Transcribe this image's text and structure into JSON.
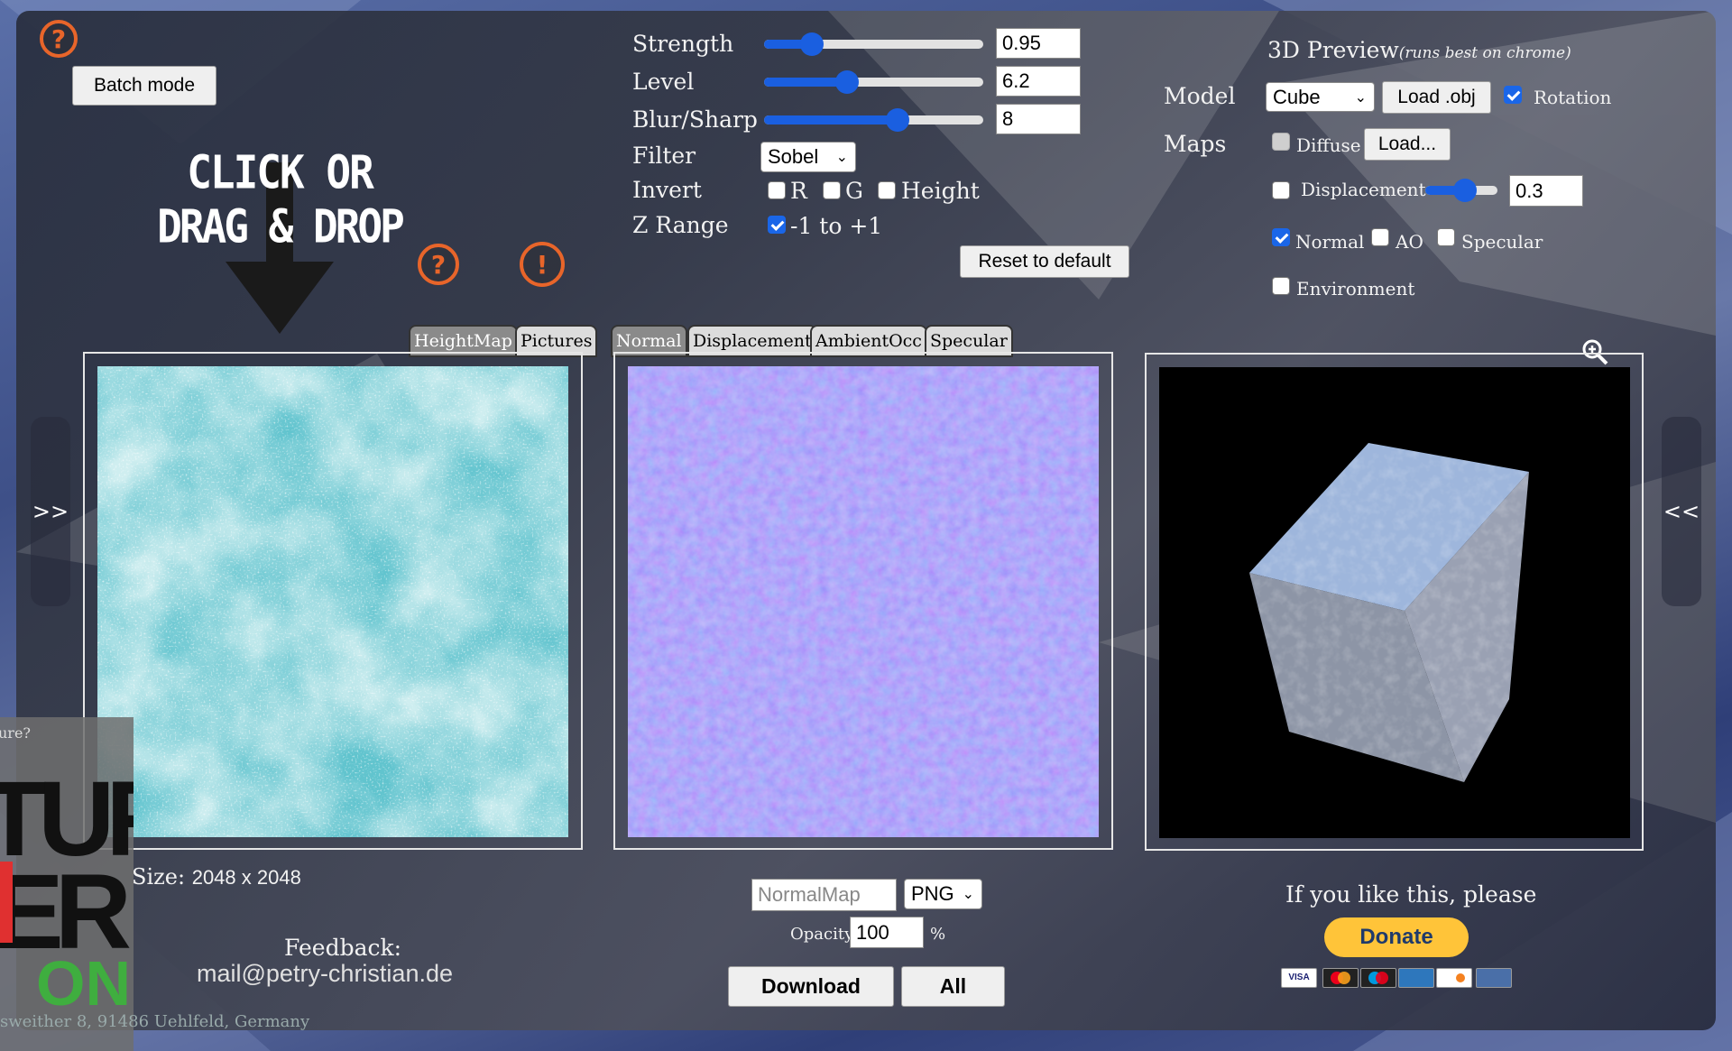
{
  "toolbar": {
    "batch_mode": "Batch mode"
  },
  "drop_zone": {
    "line1": "CLICK OR",
    "line2": "DRAG & DROP"
  },
  "icons": {
    "help": "?",
    "warn": "!"
  },
  "controls": {
    "strength": {
      "label": "Strength",
      "value": "0.95",
      "fraction": 0.22
    },
    "level": {
      "label": "Level",
      "value": "6.2",
      "fraction": 0.38
    },
    "blur": {
      "label": "Blur/Sharp",
      "value": "8",
      "fraction": 0.61
    },
    "filter": {
      "label": "Filter",
      "value": "Sobel"
    },
    "invert": {
      "label": "Invert",
      "r": "R",
      "g": "G",
      "height": "Height"
    },
    "zrange": {
      "label": "Z Range",
      "option": "-1 to +1"
    },
    "reset": "Reset to default"
  },
  "preview": {
    "title": "3D Preview",
    "subtitle": "(runs best on chrome)",
    "model_label": "Model",
    "model_value": "Cube",
    "load_obj": "Load .obj",
    "rotation": "Rotation",
    "maps_label": "Maps",
    "diffuse": "Diffuse",
    "diffuse_load": "Load...",
    "displacement": "Displacement",
    "displacement_value": "0.3",
    "displacement_fraction": 0.55,
    "normal": "Normal",
    "ao": "AO",
    "specular": "Specular",
    "environment": "Environment"
  },
  "tabs_left": [
    "HeightMap",
    "Pictures"
  ],
  "tabs_middle": [
    "Normal",
    "Displacement",
    "AmbientOcc",
    "Specular"
  ],
  "nav": {
    "expand_left": ">>",
    "expand_right": "<<"
  },
  "info": {
    "size_label": "Size:",
    "size_value": "2048 x 2048"
  },
  "feedback": {
    "label": "Feedback:",
    "email": "mail@petry-christian.de"
  },
  "footer_text": "sweither 8, 91486 Uehlfeld, Germany",
  "side_fragment": {
    "q": "ure?",
    "big1": "TUR",
    "big2": "ER",
    "onl": "ONL"
  },
  "export": {
    "filename": "NormalMap",
    "format": "PNG",
    "opacity_label": "Opacity",
    "opacity_value": "100",
    "percent": "%",
    "download": "Download",
    "all": "All"
  },
  "donate": {
    "text": "If you like this, please",
    "button": "Donate",
    "cards": [
      "VISA",
      "MC",
      "MAESTRO",
      "AMEX",
      "DISCOVER",
      "CARD"
    ]
  },
  "colors": {
    "accent": "#1a5fe0",
    "orange": "#e8652a",
    "donate_yellow": "#ffc439"
  }
}
